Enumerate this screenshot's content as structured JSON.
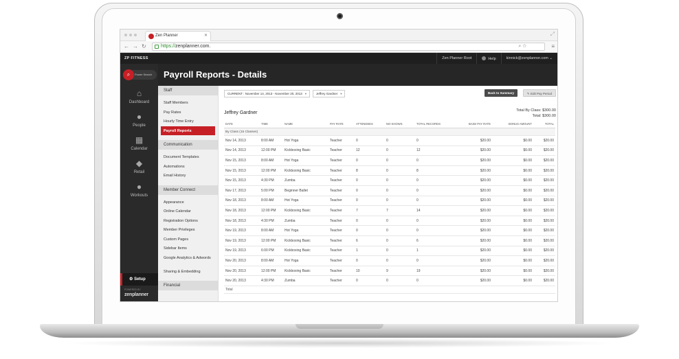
{
  "browser": {
    "tab_title": "Zen Planner",
    "url_https": "https://",
    "url_rest": "zenplanner.com."
  },
  "topbar": {
    "brand": "ZP FITNESS",
    "account": "Zen Planner Root",
    "help": "Help",
    "user": "kinnick@zenplanner.com"
  },
  "leftnav": {
    "power_search": "Power Search",
    "items": [
      {
        "label": "Dashboard",
        "icon": "home-icon"
      },
      {
        "label": "People",
        "icon": "person-icon"
      },
      {
        "label": "Calendar",
        "icon": "calendar-icon"
      },
      {
        "label": "Retail",
        "icon": "tag-icon"
      },
      {
        "label": "Workouts",
        "icon": "kettlebell-icon"
      }
    ],
    "setup": "Setup",
    "powered_by": "POWERED BY",
    "logo": "zenplanner"
  },
  "page": {
    "title": "Payroll Reports - Details"
  },
  "submenu": {
    "sections": [
      {
        "head": "Staff",
        "items": [
          "Staff Members",
          "Pay Rates",
          "Hourly Time Entry",
          "Payroll Reports"
        ]
      },
      {
        "head": "Communication",
        "items": [
          "Document Templates",
          "Automations",
          "Email History"
        ]
      },
      {
        "head": "Member Connect",
        "items": [
          "Appearance",
          "Online Calendar",
          "Registration Options",
          "Member Privileges",
          "Custom Pages",
          "Sidebar Items",
          "Google Analytics & Adwords",
          "Sharing & Embedding"
        ]
      },
      {
        "head": "Financial",
        "items": []
      }
    ],
    "active": "Payroll Reports"
  },
  "report": {
    "period_label": "CURRENT :",
    "period_value": "November 14, 2013 - November 20, 2013",
    "staff_filter": "Jeffrey Gardner",
    "back_button": "Back to Summary",
    "edit_button": "Edit Pay Period",
    "person": "Jeffrey Gardner",
    "total_by_class": "Total By Class: $300.00",
    "total": "Total: $300.00",
    "columns": [
      "Date",
      "Time",
      "Name",
      "Pay Rate",
      "Attendees",
      "No-Shows",
      "Total Records",
      "Base Pay Rate",
      "Bonus Amount",
      "Total"
    ],
    "group_label": "By Class (15 Classes)",
    "total_row_label": "Total",
    "rows": [
      [
        "Nov 14, 2013",
        "8:00 AM",
        "Hot Yoga",
        "Teacher",
        "0",
        "0",
        "0",
        "$20.00",
        "$0.00",
        "$20.00"
      ],
      [
        "Nov 14, 2013",
        "12:00 PM",
        "Kickboxing Basic",
        "Teacher",
        "12",
        "0",
        "12",
        "$20.00",
        "$0.00",
        "$20.00"
      ],
      [
        "Nov 15, 2013",
        "8:00 AM",
        "Hot Yoga",
        "Teacher",
        "0",
        "0",
        "0",
        "$20.00",
        "$0.00",
        "$20.00"
      ],
      [
        "Nov 15, 2013",
        "12:00 PM",
        "Kickboxing Basic",
        "Teacher",
        "8",
        "0",
        "8",
        "$20.00",
        "$0.00",
        "$20.00"
      ],
      [
        "Nov 15, 2013",
        "4:30 PM",
        "Zumba",
        "Teacher",
        "0",
        "0",
        "0",
        "$20.00",
        "$0.00",
        "$20.00"
      ],
      [
        "Nov 17, 2013",
        "5:00 PM",
        "Beginner Ballet",
        "Teacher",
        "0",
        "0",
        "0",
        "$20.00",
        "$0.00",
        "$20.00"
      ],
      [
        "Nov 18, 2013",
        "8:00 AM",
        "Hot Yoga",
        "Teacher",
        "0",
        "0",
        "0",
        "$20.00",
        "$0.00",
        "$20.00"
      ],
      [
        "Nov 18, 2013",
        "12:00 PM",
        "Kickboxing Basic",
        "Teacher",
        "7",
        "7",
        "14",
        "$20.00",
        "$0.00",
        "$20.00"
      ],
      [
        "Nov 18, 2013",
        "4:30 PM",
        "Zumba",
        "Teacher",
        "0",
        "0",
        "0",
        "$20.00",
        "$0.00",
        "$20.00"
      ],
      [
        "Nov 19, 2013",
        "8:00 AM",
        "Hot Yoga",
        "Teacher",
        "0",
        "0",
        "0",
        "$20.00",
        "$0.00",
        "$20.00"
      ],
      [
        "Nov 19, 2013",
        "12:00 PM",
        "Kickboxing Basic",
        "Teacher",
        "6",
        "0",
        "6",
        "$20.00",
        "$0.00",
        "$20.00"
      ],
      [
        "Nov 19, 2013",
        "6:00 PM",
        "Kickboxing Basic",
        "Teacher",
        "1",
        "0",
        "1",
        "$20.00",
        "$0.00",
        "$20.00"
      ],
      [
        "Nov 20, 2013",
        "8:00 AM",
        "Hot Yoga",
        "Teacher",
        "0",
        "0",
        "0",
        "$20.00",
        "$0.00",
        "$20.00"
      ],
      [
        "Nov 20, 2013",
        "12:00 PM",
        "Kickboxing Basic",
        "Teacher",
        "10",
        "9",
        "19",
        "$20.00",
        "$0.00",
        "$20.00"
      ],
      [
        "Nov 20, 2013",
        "4:30 PM",
        "Zumba",
        "Teacher",
        "0",
        "0",
        "0",
        "$20.00",
        "$0.00",
        "$20.00"
      ]
    ]
  },
  "colors": {
    "brand_red": "#c62026",
    "dark_header": "#262626",
    "nav_bg": "#2a2a2a"
  }
}
